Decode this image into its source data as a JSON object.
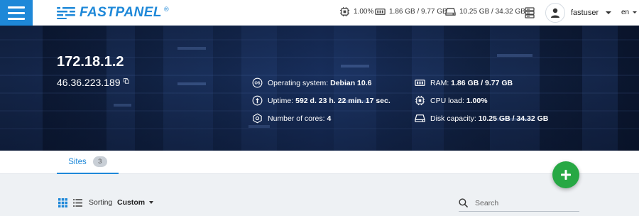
{
  "brand": {
    "name": "FASTPANEL",
    "reg": "®",
    "color": "#1e88d8"
  },
  "topbar": {
    "cpu": "1.00%",
    "ram": "1.86 GB / 9.77 GB",
    "disk": "10.25 GB / 34.32 GB",
    "username": "fastuser",
    "language": "en"
  },
  "server": {
    "hostname": "172.18.1.2",
    "ip": "46.36.223.189",
    "info": {
      "os_label": "Operating system:",
      "os_value": "Debian 10.6",
      "uptime_label": "Uptime:",
      "uptime_value": "592 d. 23 h. 22 min. 17 sec.",
      "cores_label": "Number of cores:",
      "cores_value": "4",
      "ram_label": "RAM:",
      "ram_value": "1.86 GB / 9.77 GB",
      "cpu_label": "CPU load:",
      "cpu_value": "1.00%",
      "disk_label": "Disk capacity:",
      "disk_value": "10.25 GB / 34.32 GB"
    }
  },
  "tabs": [
    {
      "label": "Sites",
      "count": "3"
    }
  ],
  "toolbar": {
    "sort_label": "Sorting",
    "sort_value": "Custom",
    "search_placeholder": "Search"
  },
  "icons": {
    "menu": "menu-icon",
    "cpu": "cpu-icon",
    "ram": "ram-icon",
    "disk": "disk-icon",
    "server": "server-icon",
    "user": "user-icon",
    "copy": "copy-icon",
    "os": "os-icon",
    "uptime": "uptime-icon",
    "cores": "cores-icon",
    "add": "plus-icon",
    "grid": "grid-view-icon",
    "list": "list-view-icon",
    "search": "search-icon"
  },
  "colors": {
    "accent": "#1e88d8",
    "fab": "#27a844",
    "hero": "#14284e"
  }
}
